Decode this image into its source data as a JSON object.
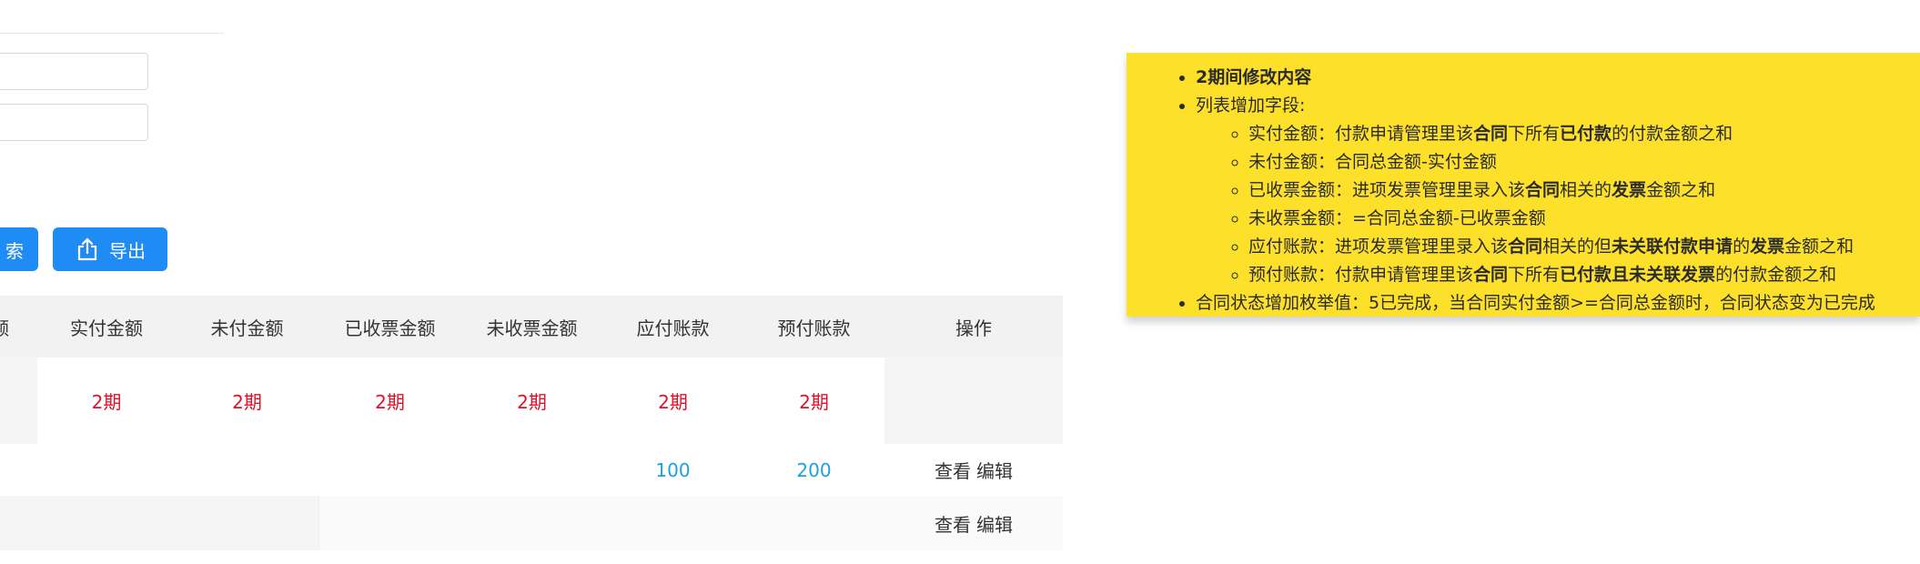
{
  "filters": {
    "input1_value": "",
    "input2_value": ""
  },
  "buttons": {
    "search_label": "索",
    "export_label": "导出"
  },
  "table": {
    "headers": [
      "额",
      "实付金额",
      "未付金额",
      "已收票金额",
      "未收票金额",
      "应付账款",
      "预付账款",
      "操作"
    ],
    "note_row": [
      "",
      "2期",
      "2期",
      "2期",
      "2期",
      "2期",
      "2期",
      ""
    ],
    "data_rows": [
      {
        "cells": [
          "",
          "",
          "",
          "",
          "",
          "100",
          "200"
        ],
        "actions": [
          "查看",
          "编辑"
        ]
      },
      {
        "cells": [
          "",
          "",
          "",
          "",
          "",
          "",
          ""
        ],
        "actions": [
          "查看",
          "编辑"
        ]
      }
    ]
  },
  "note": {
    "item1": "2期间修改内容",
    "item2": "列表增加字段:",
    "sub": [
      {
        "a": "实付金额：付款申请管理里该",
        "b1": "合同",
        "c": "下所有",
        "b2": "已付款",
        "d": "的付款金额之和"
      },
      {
        "text": "未付金额：合同总金额-实付金额"
      },
      {
        "a": "已收票金额：进项发票管理里录入该",
        "b1": "合同",
        "c": "相关的",
        "b2": "发票",
        "d": "金额之和"
      },
      {
        "text": "未收票金额：=合同总金额-已收票金额"
      },
      {
        "a": "应付账款：进项发票管理里录入该",
        "b1": "合同",
        "c": "相关的但",
        "b2": "未关联付款申请",
        "d": "的",
        "b3": "发票",
        "e": "金额之和"
      },
      {
        "a": "预付账款：付款申请管理里该",
        "b1": "合同",
        "c": "下所有",
        "b2": "已付款且未关联发票",
        "d": "的付款金额之和"
      }
    ],
    "item3": "合同状态增加枚举值：5已完成，当合同实付金额>=合同总金额时，合同状态变为已完成"
  },
  "colors": {
    "primary": "#1f8cf5",
    "note_bg": "#fde02a",
    "note_red": "#e0102a",
    "link_blue": "#1ea0dd"
  },
  "icons": {
    "export": "upload-icon"
  }
}
